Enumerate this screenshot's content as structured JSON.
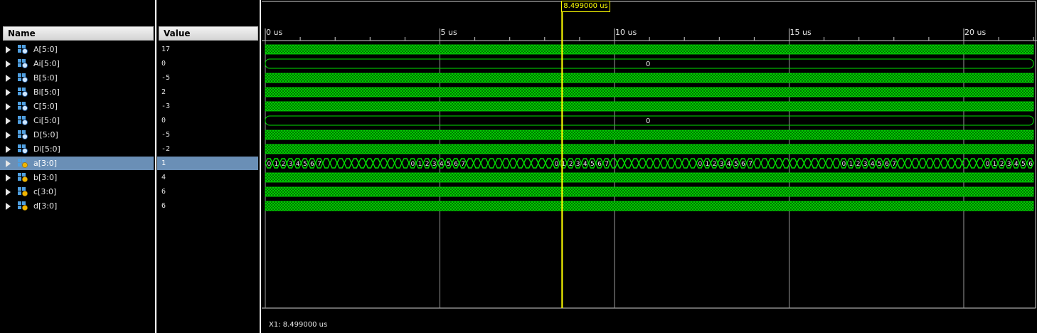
{
  "headers": {
    "name": "Name",
    "value": "Value"
  },
  "colors": {
    "wave": "#00e000",
    "cursor": "#ffff00",
    "grid": "#9a9a9a",
    "selected_row": "#6a8fb6"
  },
  "time_axis": {
    "unit": "us",
    "start": 0,
    "end": 22,
    "tick_labels": [
      "0 us",
      "5 us",
      "10 us",
      "15 us",
      "20 us"
    ],
    "tick_values": [
      0,
      5,
      10,
      15,
      20
    ]
  },
  "cursor": {
    "time_label": "8.499000 us",
    "time": 8.499,
    "readout": "X1: 8.499000 us"
  },
  "signals": [
    {
      "name": "A[5:0]",
      "value": "17",
      "kind": "bus6",
      "wave": "dense"
    },
    {
      "name": "Ai[5:0]",
      "value": "0",
      "kind": "bus6",
      "wave": "const",
      "const_label": "0"
    },
    {
      "name": "B[5:0]",
      "value": "-5",
      "kind": "bus6",
      "wave": "dense"
    },
    {
      "name": "Bi[5:0]",
      "value": "2",
      "kind": "bus6",
      "wave": "dense"
    },
    {
      "name": "C[5:0]",
      "value": "-3",
      "kind": "bus6",
      "wave": "dense"
    },
    {
      "name": "Ci[5:0]",
      "value": "0",
      "kind": "bus6",
      "wave": "const",
      "const_label": "0"
    },
    {
      "name": "D[5:0]",
      "value": "-5",
      "kind": "bus6",
      "wave": "dense"
    },
    {
      "name": "Di[5:0]",
      "value": "-2",
      "kind": "bus6",
      "wave": "dense"
    },
    {
      "name": "a[3:0]",
      "value": "1",
      "kind": "bus4",
      "wave": "counter",
      "selected": true,
      "counter_labels": [
        "0",
        "1",
        "2",
        "3",
        "4",
        "5",
        "6",
        "7"
      ]
    },
    {
      "name": "b[3:0]",
      "value": "4",
      "kind": "bus4",
      "wave": "dense"
    },
    {
      "name": "c[3:0]",
      "value": "6",
      "kind": "bus4",
      "wave": "dense"
    },
    {
      "name": "d[3:0]",
      "value": "6",
      "kind": "bus4",
      "wave": "dense"
    }
  ]
}
